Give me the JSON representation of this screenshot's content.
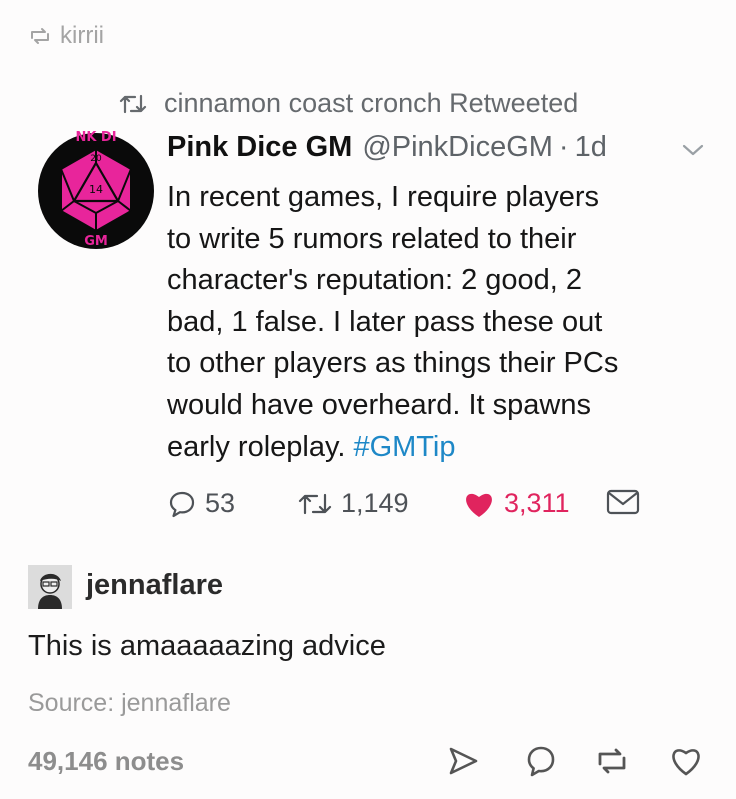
{
  "post": {
    "reblogged_from": "kirrii",
    "notes": "49,146 notes",
    "source_label": "Source: jennaflare"
  },
  "tweet": {
    "retweeted_by": "cinnamon coast cronch Retweeted",
    "author_name": "Pink Dice GM",
    "author_handle": "@PinkDiceGM",
    "separator": "·",
    "time": "1d",
    "avatar_text_top": "NK DI",
    "avatar_text_bottom": "GM",
    "body_lines": [
      "In recent games, I require players",
      "to write 5 rumors related to their",
      "character's reputation: 2 good, 2",
      "bad, 1 false. I later pass these out",
      "to other players as things their PCs",
      "would have overheard. It spawns",
      "early roleplay. "
    ],
    "hashtag": "#GMTip",
    "replies": "53",
    "retweets": "1,149",
    "likes": "3,311"
  },
  "user": {
    "name": "jennaflare",
    "comment": "This is amaaaaazing advice"
  },
  "colors": {
    "hashtag": "#1e88c7",
    "like": "#e0245e",
    "avatar_pink": "#e8259b"
  },
  "icons": [
    "reblog-icon",
    "retweet-icon",
    "chevron-down-icon",
    "reply-icon",
    "like-icon",
    "mail-icon",
    "share-icon",
    "comment-icon",
    "heart-icon"
  ]
}
